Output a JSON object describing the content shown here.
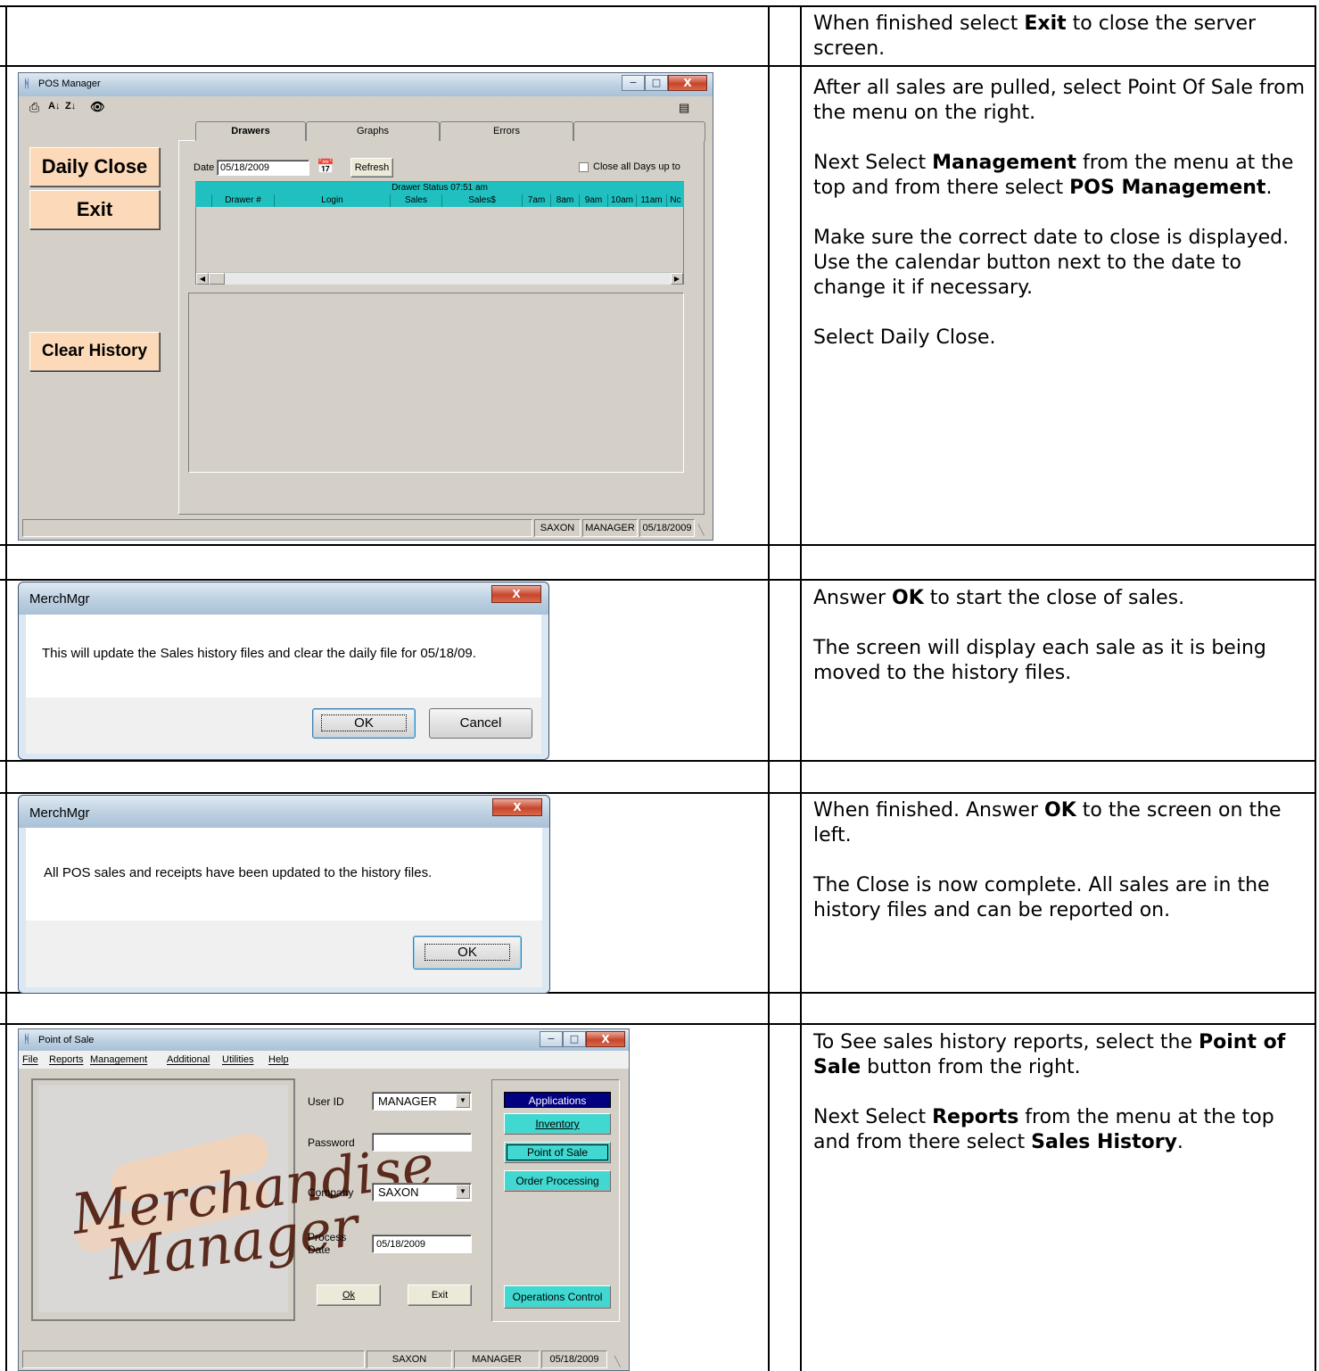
{
  "rows": [
    {
      "paragraphs": [
        [
          {
            "t": "When finished select "
          },
          {
            "b": "Exit"
          },
          {
            "t": " to close the server screen."
          }
        ]
      ]
    },
    {
      "paragraphs": [
        [
          {
            "t": "After all sales are pulled, select Point Of Sale from the menu on the right."
          }
        ],
        [
          {
            "t": "Next Select "
          },
          {
            "b": "Management"
          },
          {
            "t": " from the menu at the top and from there select "
          },
          {
            "b": "POS Management"
          },
          {
            "t": "."
          }
        ],
        [
          {
            "t": "Make sure the correct date to close is displayed.  Use the calendar button next to the date to change it if necessary."
          }
        ],
        [
          {
            "t": "Select Daily Close."
          }
        ]
      ]
    },
    {
      "paragraphs": [
        [
          {
            "t": "Answer "
          },
          {
            "b": "OK"
          },
          {
            "t": " to start the close of sales."
          }
        ],
        [
          {
            "t": "The screen will display each sale as it is being moved to the history files."
          }
        ]
      ]
    },
    {
      "paragraphs": [
        [
          {
            "t": "When finished.  Answer "
          },
          {
            "b": "OK"
          },
          {
            "t": " to the screen on the left."
          }
        ],
        [
          {
            "t": "The Close is now complete.  All sales are in the history files and can be reported on."
          }
        ]
      ]
    },
    {
      "paragraphs": [
        [
          {
            "t": "To See sales history reports,  select the "
          },
          {
            "b": "Point of Sale"
          },
          {
            "t": " button from the right."
          }
        ],
        [
          {
            "t": "Next Select "
          },
          {
            "b": "Reports"
          },
          {
            "t": " from the menu at the top and from there select "
          },
          {
            "b": "Sales History"
          },
          {
            "t": "."
          }
        ]
      ]
    }
  ],
  "pos_manager": {
    "title": "POS Manager",
    "daily_close": "Daily Close",
    "exit": "Exit",
    "clear_history": "Clear History",
    "tabs": [
      "Drawers",
      "Graphs",
      "Errors"
    ],
    "date_label": "Date",
    "date_value": "05/18/2009",
    "refresh": "Refresh",
    "close_all_days": "Close all Days up to",
    "grid_title": "Drawer Status    07:51 am",
    "columns": [
      "Drawer #",
      "Login",
      "Sales",
      "Sales$",
      "7am",
      "8am",
      "9am",
      "10am",
      "11am",
      "Nc"
    ],
    "status": {
      "company": "SAXON",
      "user": "MANAGER",
      "date": "05/18/2009"
    }
  },
  "dialog1": {
    "title": "MerchMgr",
    "message": "This will update the Sales history files and clear the daily file for 05/18/09.",
    "ok": "OK",
    "cancel": "Cancel",
    "close_glyph": "X"
  },
  "dialog2": {
    "title": "MerchMgr",
    "message": "All POS sales and receipts have been updated to the history files.",
    "ok": "OK",
    "close_glyph": "X"
  },
  "pos_window": {
    "title": "Point of Sale",
    "menu": [
      "File",
      "Reports",
      "Management",
      "Additional",
      "Utilities",
      "Help"
    ],
    "logo_line1": "Merchandise",
    "logo_line2": "Manager",
    "user_id_label": "User ID",
    "user_id_value": "MANAGER",
    "password_label": "Password",
    "company_label": "Company",
    "company_value": "SAXON",
    "process_date_label": "Process Date",
    "process_date_value": "05/18/2009",
    "ok": "Ok",
    "exit": "Exit",
    "applications": "Applications",
    "inventory": "Inventory",
    "point_of_sale": "Point of Sale",
    "order_processing": "Order Processing",
    "operations_control": "Operations Control",
    "status": {
      "company": "SAXON",
      "user": "MANAGER",
      "date": "05/18/2009"
    }
  },
  "colors": {
    "grid_teal": "#20c0c0",
    "button_peach": "#fcd9b8",
    "app_button_teal": "#40d8d0",
    "applications_navy": "#000080"
  },
  "icons": [
    "printer-icon",
    "sort-ascending-icon",
    "sort-descending-icon",
    "binoculars-icon",
    "calendar-icon",
    "grid-icon",
    "dropdown-arrow-icon"
  ]
}
